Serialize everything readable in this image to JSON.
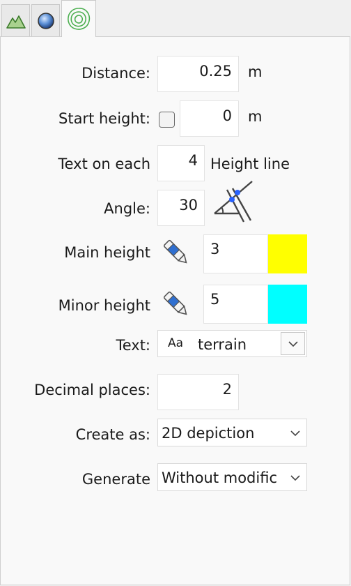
{
  "tabs": [
    {
      "name": "terrain-mountain-tab",
      "icon": "mountain-icon"
    },
    {
      "name": "sphere-tab",
      "icon": "sphere-icon"
    },
    {
      "name": "contour-lines-tab",
      "icon": "contour-lines-icon",
      "active": true
    }
  ],
  "form": {
    "distance": {
      "label": "Distance:",
      "value": "0.25",
      "unit": "m"
    },
    "start_height": {
      "label": "Start height:",
      "checked": false,
      "value": "0",
      "unit": "m"
    },
    "text_on_each": {
      "label": "Text on each",
      "value": "4",
      "suffix": "Height line"
    },
    "angle": {
      "label": "Angle:",
      "value": "30",
      "icon": "angle-diagram-icon"
    },
    "main_height": {
      "label": "Main height",
      "value": "3",
      "color": "#ffff00",
      "icon": "pencil-icon"
    },
    "minor_height": {
      "label": "Minor height",
      "value": "5",
      "color": "#00ffff",
      "icon": "pencil-icon"
    },
    "text": {
      "label": "Text:",
      "font_icon": "Aa",
      "value": "terrain"
    },
    "decimal_places": {
      "label": "Decimal places:",
      "value": "2"
    },
    "create_as": {
      "label": "Create as:",
      "value": "2D depiction"
    },
    "generate": {
      "label": "Generate",
      "value": "Without modific"
    }
  }
}
